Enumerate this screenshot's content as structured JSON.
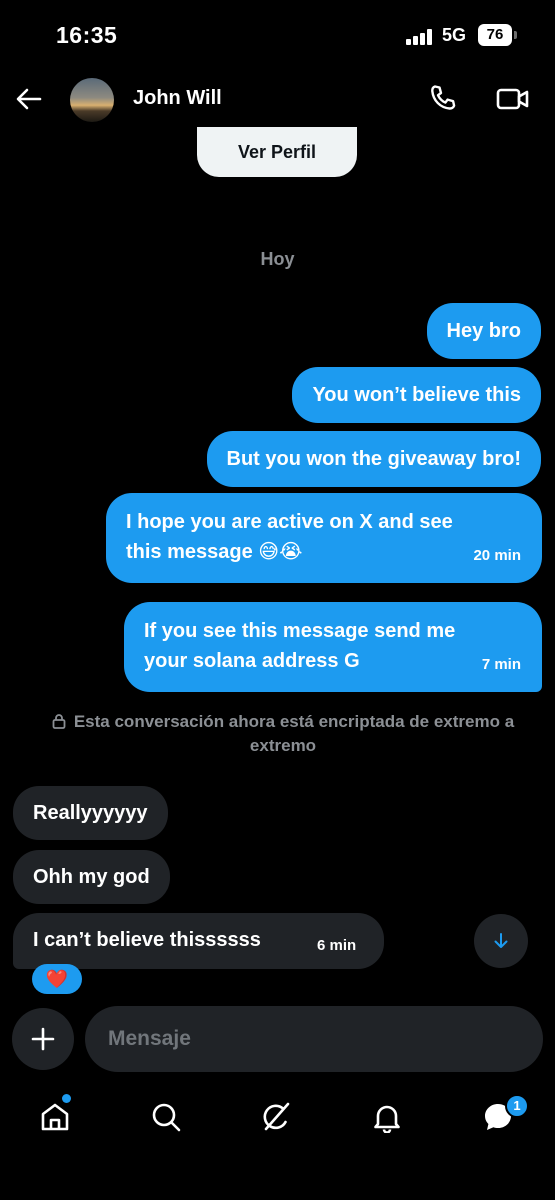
{
  "status_bar": {
    "time": "16:35",
    "network": "5G",
    "battery": "76"
  },
  "header": {
    "contact_name": "John Will"
  },
  "profile_button": "Ver Perfil",
  "day_label": "Hoy",
  "messages_sent": [
    {
      "text": "Hey bro"
    },
    {
      "text": "You won’t believe this"
    },
    {
      "text": "But you won the giveaway bro!"
    },
    {
      "line1": "I hope you are active on X and see",
      "line2": "this message 😅😭",
      "time": "20 min"
    },
    {
      "line1": "If you see this message send me",
      "line2": "your solana address G",
      "time": "7 min"
    }
  ],
  "encryption_note": "Esta conversación ahora está encriptada de extremo a extremo",
  "messages_received": [
    {
      "text": "Reallyyyyyy"
    },
    {
      "text": "Ohh my god"
    },
    {
      "text": "I can’t believe thissssss",
      "time": "6 min"
    }
  ],
  "reaction": "❤️",
  "composer": {
    "placeholder": "Mensaje"
  },
  "bottom_nav": {
    "items": [
      "home-icon",
      "search-icon",
      "grok-icon",
      "notifications-icon",
      "messages-icon"
    ],
    "messages_badge": "1"
  },
  "colors": {
    "accent": "#1d9bf0",
    "received_bubble": "#202327",
    "background": "#000000",
    "muted_text": "#8b8f94"
  }
}
